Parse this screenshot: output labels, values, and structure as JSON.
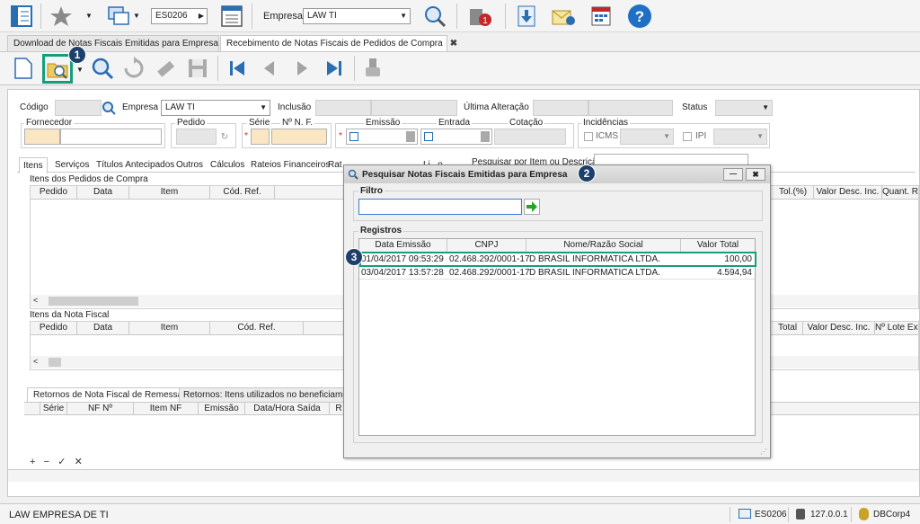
{
  "toolbar1": {
    "screen_code": "ES0206",
    "empresa_label": "Empresa",
    "empresa_value": "LAW TI",
    "notif_count": "1"
  },
  "doc_tabs": [
    {
      "label": "Download de Notas Fiscais Emitidas para Empresa",
      "close": "✖"
    },
    {
      "label": "Recebimento de Notas Fiscais de Pedidos de Compra",
      "close": "✖"
    }
  ],
  "form": {
    "codigo_label": "Código",
    "empresa_label": "Empresa",
    "empresa_value": "LAW TI",
    "inclusao_label": "Inclusão",
    "ultima_alteracao_label": "Última Alteração",
    "status_label": "Status",
    "fornecedor_label": "Fornecedor",
    "pedido_label": "Pedido",
    "serie_label": "Série",
    "nnf_label": "Nº N. F.",
    "emissao_label": "Emissão",
    "entrada_label": "Entrada",
    "cotacao_label": "Cotação",
    "incidencias_label": "Incidências",
    "icms_label": "ICMS",
    "ipi_label": "IPI",
    "required_mark": "*",
    "tabs": [
      "Itens",
      "Serviços",
      "Títulos Antecipados",
      "Outros",
      "Cálculos",
      "Rateios Financeiros",
      "Rat",
      "Li...o"
    ],
    "pesquisar_label": "Pesquisar por Item ou Descrição:",
    "itens_pedidos_title": "Itens dos Pedidos de Compra",
    "itens_pedidos_cols": [
      "Pedido",
      "Data",
      "Item",
      "Cód. Ref."
    ],
    "itens_pedidos_right_cols": [
      "Tol.(%)",
      "Valor Desc. Inc.",
      "Quant. R"
    ],
    "itens_nf_title": "Itens da Nota Fiscal",
    "itens_nf_cols": [
      "Pedido",
      "Data",
      "Item",
      "Cód. Ref."
    ],
    "itens_nf_right_cols": [
      "Total",
      "Valor Desc. Inc.",
      "Nº Lote Ext"
    ],
    "retornos_tabs": [
      "Retornos de Nota Fiscal de Remessa",
      "Retornos: Itens utilizados no beneficiament"
    ],
    "retornos_cols": [
      "Série",
      "NF Nº",
      "Item NF",
      "Emissão",
      "Data/Hora Saída",
      "R"
    ],
    "nav_buttons": [
      "+",
      "−",
      "✓",
      "✕"
    ]
  },
  "dialog": {
    "title": "Pesquisar Notas Fiscais Emitidas para Empresa",
    "filtro_label": "Filtro",
    "filtro_value": "",
    "registros_label": "Registros",
    "columns": [
      "Data Emissão",
      "CNPJ",
      "Nome/Razão Social",
      "Valor Total"
    ],
    "rows": [
      {
        "data": "01/04/2017 09:53:29",
        "cnpj": "02.468.292/0001-17",
        "nome": "D BRASIL INFORMATICA LTDA.",
        "valor": "100,00"
      },
      {
        "data": "03/04/2017 13:57:28",
        "cnpj": "02.468.292/0001-17",
        "nome": "D BRASIL INFORMATICA LTDA.",
        "valor": "4.594,94"
      }
    ],
    "minimize": "—",
    "close": "✖"
  },
  "badges": [
    "1",
    "2",
    "3"
  ],
  "statusbar": {
    "company": "LAW EMPRESA DE TI",
    "screen": "ES0206",
    "ip": "127.0.0.1",
    "db": "DBCorp4"
  },
  "colors": {
    "highlight": "#169e7c",
    "badge": "#1d3f6b",
    "yellow": "#fbe6c3",
    "help": "#1f6fc4",
    "arrow": "#2ca02c"
  }
}
